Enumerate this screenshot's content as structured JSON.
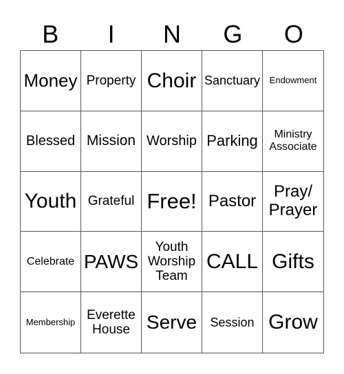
{
  "header": [
    "B",
    "I",
    "N",
    "G",
    "O"
  ],
  "cells": [
    {
      "text": "Money",
      "size": "s26"
    },
    {
      "text": "Property",
      "size": "s19"
    },
    {
      "text": "Choir",
      "size": "s30"
    },
    {
      "text": "Sanctuary",
      "size": "s18"
    },
    {
      "text": "Endowment",
      "size": "s13"
    },
    {
      "text": "Blessed",
      "size": "s20"
    },
    {
      "text": "Mission",
      "size": "s21"
    },
    {
      "text": "Worship",
      "size": "s20"
    },
    {
      "text": "Parking",
      "size": "s22"
    },
    {
      "text": "Ministry\nAssociate",
      "size": "s16"
    },
    {
      "text": "Youth",
      "size": "s30"
    },
    {
      "text": "Grateful",
      "size": "s19"
    },
    {
      "text": "Free!",
      "size": "s31"
    },
    {
      "text": "Pastor",
      "size": "s24"
    },
    {
      "text": "Pray/\nPrayer",
      "size": "s24"
    },
    {
      "text": "Celebrate",
      "size": "s16"
    },
    {
      "text": "PAWS",
      "size": "s28"
    },
    {
      "text": "Youth\nWorship\nTeam",
      "size": "s19"
    },
    {
      "text": "CALL",
      "size": "s30"
    },
    {
      "text": "Gifts",
      "size": "s30"
    },
    {
      "text": "Membership",
      "size": "s13"
    },
    {
      "text": "Everette\nHouse",
      "size": "s19"
    },
    {
      "text": "Serve",
      "size": "s28"
    },
    {
      "text": "Session",
      "size": "s18"
    },
    {
      "text": "Grow",
      "size": "s30"
    }
  ]
}
